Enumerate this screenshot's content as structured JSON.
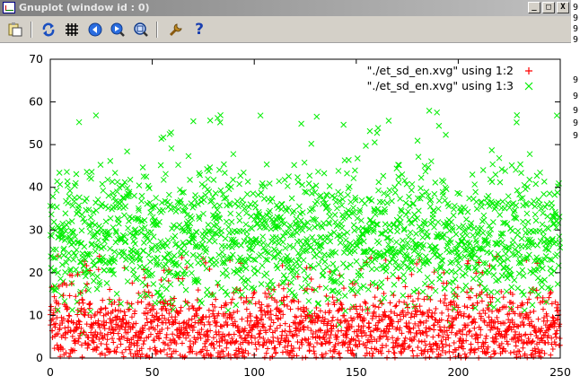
{
  "window": {
    "title": "Gnuplot (window id : 0)",
    "controls": {
      "minimize": "_",
      "maximize": "□",
      "close": "X"
    }
  },
  "toolbar": {
    "buttons": [
      {
        "name": "copy-to-clipboard-icon"
      },
      {
        "name": "replot-icon"
      },
      {
        "name": "grid-icon"
      },
      {
        "name": "previous-zoom-icon"
      },
      {
        "name": "next-zoom-icon"
      },
      {
        "name": "autoscale-icon"
      },
      {
        "name": "options-icon"
      },
      {
        "name": "help-icon",
        "glyph": "?"
      }
    ]
  },
  "background_text": {
    "right_edge_digits": [
      "9",
      "9",
      "9",
      "9",
      "9",
      "9",
      "9",
      "9",
      "9"
    ]
  },
  "chart_data": {
    "type": "scatter",
    "title": "",
    "xlabel": "",
    "ylabel": "",
    "xlim": [
      0,
      250
    ],
    "ylim": [
      0,
      70
    ],
    "xticks": [
      0,
      50,
      100,
      150,
      200,
      250
    ],
    "yticks": [
      0,
      10,
      20,
      30,
      40,
      50,
      60,
      70
    ],
    "grid": false,
    "legend_position": "top-right",
    "series": [
      {
        "name": "\"./et_sd_en.xvg\" using 1:2",
        "marker": "+",
        "color": "#ff0000",
        "points_per_x": 7,
        "y_range": [
          0,
          38
        ],
        "typical_mean": 7
      },
      {
        "name": "\"./et_sd_en.xvg\" using 1:3",
        "marker": "x",
        "color": "#00ee00",
        "points_per_x": 7,
        "y_range": [
          2,
          63
        ],
        "typical_mean": 28
      }
    ]
  }
}
